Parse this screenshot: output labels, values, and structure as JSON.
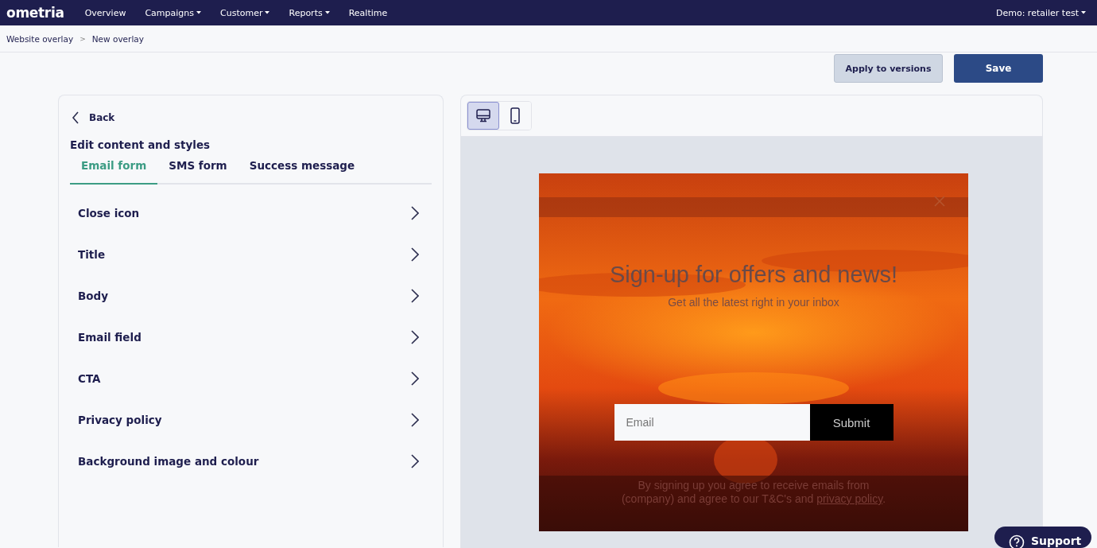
{
  "nav": {
    "logo": "ometria",
    "items": [
      {
        "label": "Overview",
        "dropdown": false
      },
      {
        "label": "Campaigns",
        "dropdown": true
      },
      {
        "label": "Customer",
        "dropdown": true
      },
      {
        "label": "Reports",
        "dropdown": true
      },
      {
        "label": "Realtime",
        "dropdown": false
      }
    ],
    "account": {
      "label": "Demo: retailer test",
      "dropdown": true
    }
  },
  "breadcrumb": [
    "Website overlay",
    "New overlay"
  ],
  "breadcrumb_separator": ">",
  "actions": [
    {
      "label": "Apply to versions",
      "kind": "secondary"
    },
    {
      "label": "Save",
      "kind": "primary"
    }
  ],
  "editor": {
    "back": "Back",
    "heading": "Edit content and styles",
    "tabs": [
      {
        "label": "Email form",
        "selected": true
      },
      {
        "label": "SMS form",
        "selected": false
      },
      {
        "label": "Success message",
        "selected": false
      }
    ],
    "sections": [
      "Close icon",
      "Title",
      "Body",
      "Email field",
      "CTA",
      "Privacy policy",
      "Background image and colour"
    ]
  },
  "preview": {
    "devices": [
      {
        "kind": "desktop",
        "selected": true
      },
      {
        "kind": "mobile",
        "selected": false
      }
    ],
    "overlay": {
      "title": "Sign-up for offers and news!",
      "subtitle": "Get all the latest right in your inbox",
      "email_placeholder": "Email",
      "submit": "Submit",
      "legal": "By signing up you agree to receive emails from (company) and agree to our T&C's and",
      "legal_link": "privacy policy",
      "legal_end": "."
    }
  },
  "support": "Support"
}
